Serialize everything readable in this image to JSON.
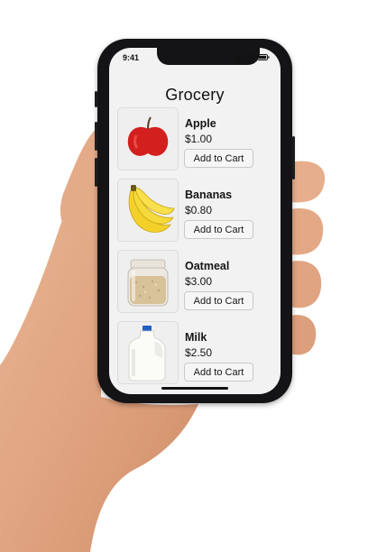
{
  "status_bar": {
    "time": "9:41",
    "signal_icon": "signal-bars-icon",
    "wifi_icon": "wifi-icon",
    "battery_icon": "battery-icon"
  },
  "app": {
    "title": "Grocery"
  },
  "products": [
    {
      "name": "Apple",
      "price": "$1.00",
      "button_label": "Add to Cart",
      "image": "apple-image"
    },
    {
      "name": "Bananas",
      "price": "$0.80",
      "button_label": "Add to Cart",
      "image": "bananas-image"
    },
    {
      "name": "Oatmeal",
      "price": "$3.00",
      "button_label": "Add to Cart",
      "image": "oatmeal-jar-image"
    },
    {
      "name": "Milk",
      "price": "$2.50",
      "button_label": "Add to Cart",
      "image": "milk-jug-image"
    }
  ],
  "colors": {
    "screen_background": "#f2f2f3",
    "phone_frame": "#141416",
    "skin": "#e3a986",
    "apple_red": "#d41f1f",
    "banana_yellow": "#f3d02a",
    "milk_cap": "#1f5fc4"
  }
}
